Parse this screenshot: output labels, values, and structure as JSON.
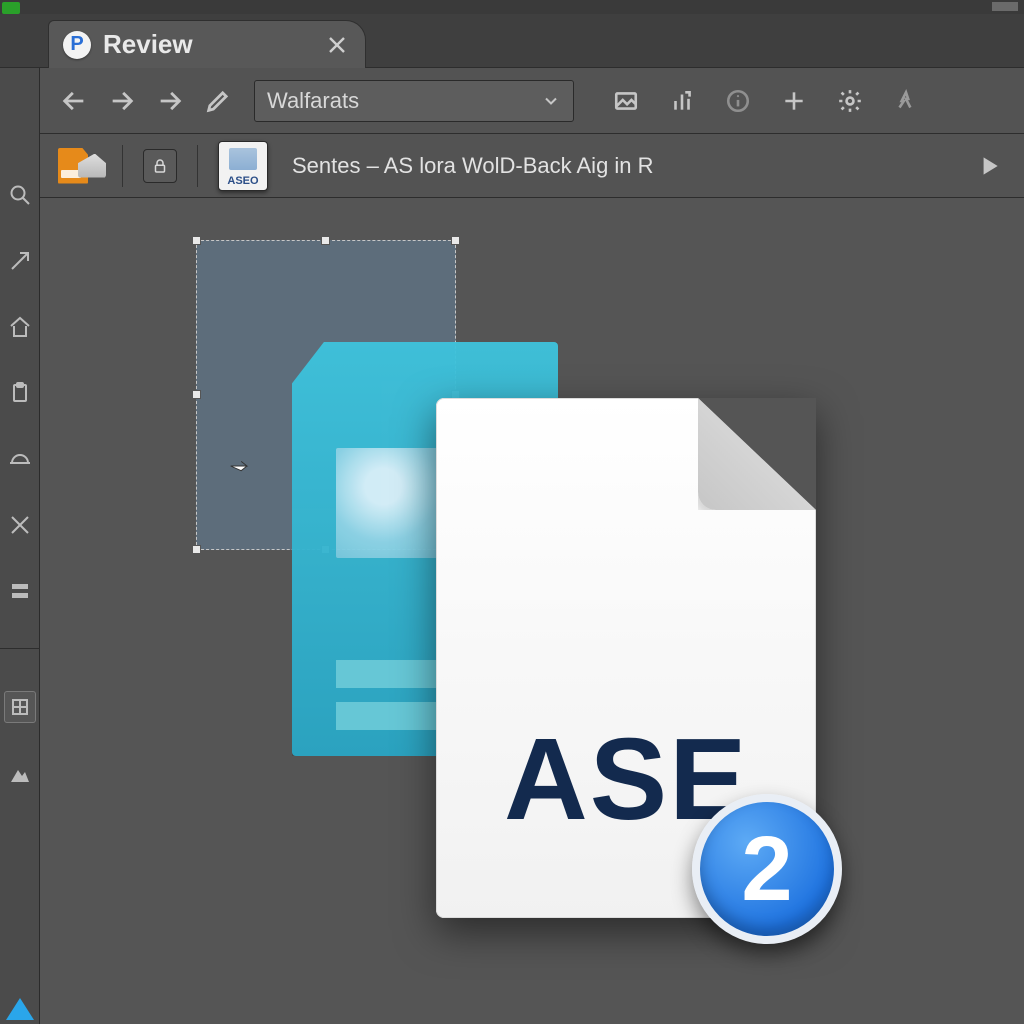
{
  "tab": {
    "icon_letter": "P",
    "title": "Review"
  },
  "navbar": {
    "address_value": "Walfarats"
  },
  "subbar": {
    "aseo_thumb_label": "ASEO",
    "document_title": "Sentes – AS lora WolD-Back Aig in R"
  },
  "file_graphic": {
    "label": "ASE",
    "badge_number": "2"
  }
}
